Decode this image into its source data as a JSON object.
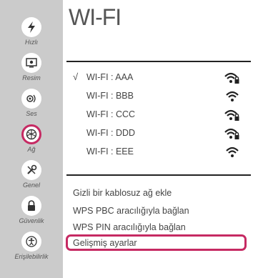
{
  "sidebar": {
    "items": [
      {
        "label": "Hızlı",
        "icon": "quick-icon",
        "active": false
      },
      {
        "label": "Resim",
        "icon": "picture-icon",
        "active": false
      },
      {
        "label": "Ses",
        "icon": "sound-icon",
        "active": false
      },
      {
        "label": "Ağ",
        "icon": "network-icon",
        "active": true
      },
      {
        "label": "Genel",
        "icon": "general-icon",
        "active": false
      },
      {
        "label": "Güvenlik",
        "icon": "lock-icon",
        "active": false
      },
      {
        "label": "Erişilebilirlik",
        "icon": "accessibility-icon",
        "active": false
      }
    ]
  },
  "main": {
    "title": "WI-FI",
    "networks": [
      {
        "check": "√",
        "name": "WI-FI : AAA",
        "secured": true
      },
      {
        "check": "",
        "name": "WI-FI : BBB",
        "secured": false
      },
      {
        "check": "",
        "name": "WI-FI : CCC",
        "secured": true
      },
      {
        "check": "",
        "name": "WI-FI : DDD",
        "secured": true
      },
      {
        "check": "",
        "name": "WI-FI : EEE",
        "secured": false
      }
    ],
    "menu": [
      {
        "label": "Gizli bir kablosuz ağ ekle"
      },
      {
        "label": "WPS PBC aracılığıyla bağlan"
      },
      {
        "label": "WPS PIN aracılığıyla bağlan"
      },
      {
        "label": "Gelişmiş ayarlar",
        "highlighted": true
      }
    ]
  },
  "colors": {
    "accent": "#c62a63",
    "sidebar_bg": "#cbcbcb"
  }
}
